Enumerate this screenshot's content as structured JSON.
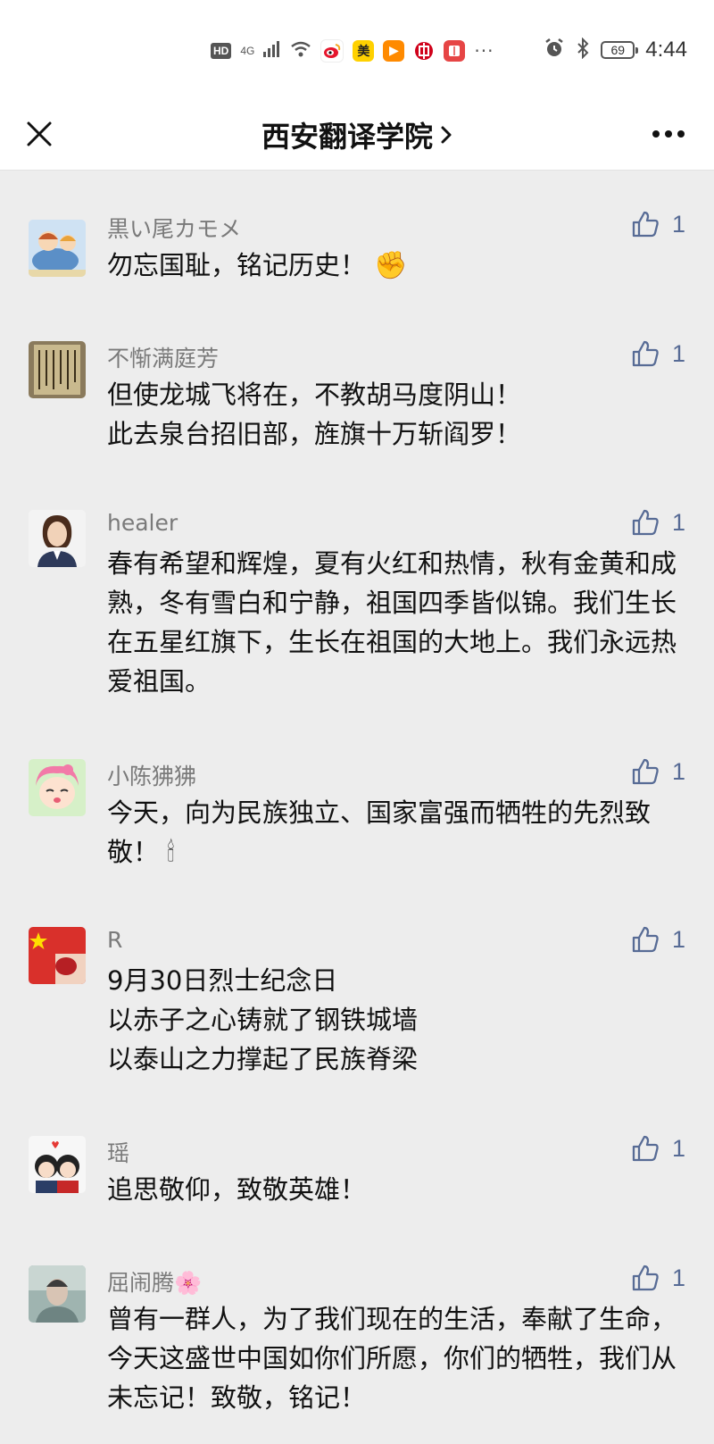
{
  "status_bar": {
    "hd": "HD",
    "network": "4G",
    "app_icons": [
      {
        "name": "weibo-icon",
        "label": "",
        "color": "#f5b400"
      },
      {
        "name": "meituan-icon",
        "label": "美",
        "color": "#ffd100"
      },
      {
        "name": "video-play-icon",
        "label": "▶",
        "color": "#ff8a00"
      },
      {
        "name": "bank-icon",
        "label": "",
        "color": "#d0021b"
      },
      {
        "name": "reader-icon",
        "label": "",
        "color": "#e64545"
      }
    ],
    "more": "···",
    "battery": "69",
    "time": "4:44"
  },
  "navbar": {
    "title": "西安翻译学院",
    "chevron": "›"
  },
  "accent_color": "#576b95",
  "comments": [
    {
      "avatar_icon": "cartoon-whale-avatar",
      "username": "黒い尾カモメ",
      "content": "勿忘国耻，铭记历史！",
      "emoji": "✊",
      "likes": "1"
    },
    {
      "avatar_icon": "calligraphy-avatar",
      "username": "不惭满庭芳",
      "content": "但使龙城飞将在，不教胡马度阴山！\n此去泉台招旧部，旌旗十万斩阎罗！",
      "emoji": "",
      "likes": "1"
    },
    {
      "avatar_icon": "woman-portrait-avatar",
      "username": "healer",
      "content": "春有希望和辉煌，夏有火红和热情，秋有金黄和成熟，冬有雪白和宁静，祖国四季皆似锦。我们生长在五星红旗下，生长在祖国的大地上。我们永远热爱祖国。",
      "emoji": "",
      "likes": "1"
    },
    {
      "avatar_icon": "cartoon-girl-avatar",
      "username": "小陈狒狒",
      "content": "今天，向为民族独立、国家富强而牺牲的先烈致敬！",
      "emoji": "🕯",
      "likes": "1"
    },
    {
      "avatar_icon": "flag-avatar",
      "username": "R",
      "content": "9月30日烈士纪念日\n以赤子之心铸就了钢铁城墙\n以泰山之力撑起了民族脊梁",
      "emoji": "",
      "likes": "1"
    },
    {
      "avatar_icon": "cartoon-couple-avatar",
      "username": "瑶",
      "content": "追思敬仰，致敬英雄！",
      "emoji": "",
      "likes": "1"
    },
    {
      "avatar_icon": "person-photo-avatar",
      "username": "屈闹腾🌸",
      "content": "曾有一群人，为了我们现在的生活，奉献了生命，今天这盛世中国如你们所愿，你们的牺牲，我们从未忘记！致敬，铭记！",
      "emoji": "",
      "likes": "1"
    }
  ]
}
